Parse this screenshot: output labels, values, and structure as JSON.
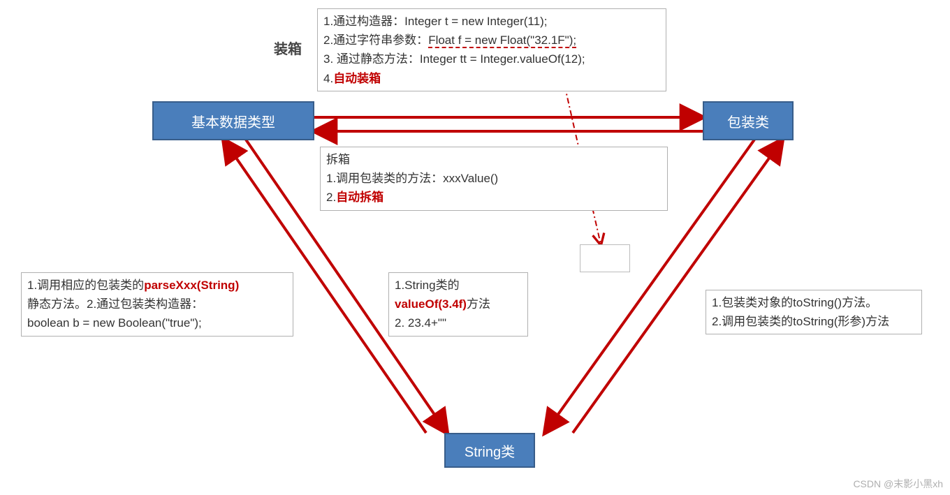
{
  "nodes": {
    "primitive": "基本数据类型",
    "wrapper": "包装类",
    "string": "String类"
  },
  "labels": {
    "boxing_title": "装箱"
  },
  "boxing_box": {
    "l1a": "1.通过构造器：Integer t = new Integer(11);",
    "l2a": "2.通过字符串参数：",
    "l2b": "Float f = new Float(\"32.1F\");",
    "l3a": "3. 通过静态方法：Integer tt = Integer.valueOf(12);",
    "l4a": "4.",
    "l4b": "自动装箱"
  },
  "unboxing_box": {
    "l1": "拆箱",
    "l2": "1.调用包装类的方法：xxxValue()",
    "l3a": "2.",
    "l3b": "自动拆箱"
  },
  "string_to_prim": {
    "l1a": "1.调用相应的包装类的",
    "l1b": "parseXxx(String)",
    "l2": "静态方法。2.通过包装类构造器：",
    "l3": "boolean b = new Boolean(\"true\");"
  },
  "prim_to_string": {
    "l1": "1.String类的",
    "l2a": "valueOf(3.4f)",
    "l2b": "方法",
    "l3": "2. 23.4+\"\""
  },
  "wrapper_to_string": {
    "l1": "1.包装类对象的toString()方法。",
    "l2": "2.调用包装类的toString(形参)方法"
  },
  "watermark": "CSDN @末影小黑xh"
}
